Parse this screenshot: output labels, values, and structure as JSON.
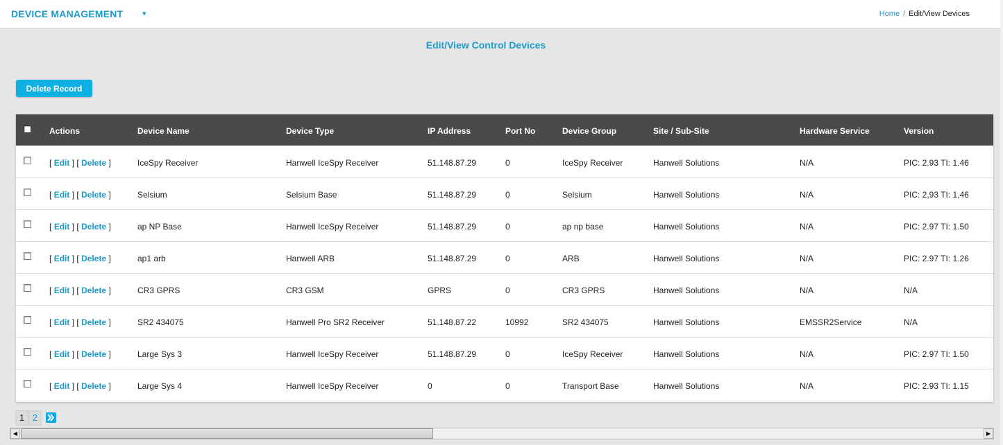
{
  "header": {
    "brand": "DEVICE MANAGEMENT",
    "brand_caret": "▾"
  },
  "breadcrumb": {
    "home": "Home",
    "separator": "/",
    "current": "Edit/View Devices"
  },
  "page_title": "Edit/View Control Devices",
  "toolbar": {
    "delete_record_label": "Delete Record"
  },
  "table": {
    "columns": [
      "Actions",
      "Device Name",
      "Device Type",
      "IP Address",
      "Port No",
      "Device Group",
      "Site / Sub-Site",
      "Hardware Service",
      "Version"
    ],
    "action_labels": {
      "open": "[",
      "edit": "Edit",
      "mid": "] [",
      "delete": "Delete",
      "close": "]"
    },
    "rows": [
      {
        "name": "IceSpy Receiver",
        "type": "Hanwell IceSpy Receiver",
        "ip": "51.148.87.29",
        "port": "0",
        "group": "IceSpy Receiver",
        "site": "Hanwell Solutions",
        "service": "N/A",
        "version": "PIC: 2.93 TI: 1.46"
      },
      {
        "name": "Selsium",
        "type": "Selsium Base",
        "ip": "51.148.87.29",
        "port": "0",
        "group": "Selsium",
        "site": "Hanwell Solutions",
        "service": "N/A",
        "version": "PIC: 2,93 TI: 1,46"
      },
      {
        "name": "ap NP Base",
        "type": "Hanwell IceSpy Receiver",
        "ip": "51.148.87.29",
        "port": "0",
        "group": "ap np base",
        "site": "Hanwell Solutions",
        "service": "N/A",
        "version": "PIC: 2.97 TI: 1.50"
      },
      {
        "name": "ap1 arb",
        "type": "Hanwell ARB",
        "ip": "51.148.87.29",
        "port": "0",
        "group": "ARB",
        "site": "Hanwell Solutions",
        "service": "N/A",
        "version": "PIC: 2.97 TI: 1.26"
      },
      {
        "name": "CR3 GPRS",
        "type": "CR3 GSM",
        "ip": "GPRS",
        "port": "0",
        "group": "CR3 GPRS",
        "site": "Hanwell Solutions",
        "service": "N/A",
        "version": "N/A"
      },
      {
        "name": "SR2 434075",
        "type": "Hanwell Pro SR2 Receiver",
        "ip": "51.148.87.22",
        "port": "10992",
        "group": "SR2 434075",
        "site": "Hanwell Solutions",
        "service": "EMSSR2Service",
        "version": "N/A"
      },
      {
        "name": "Large Sys 3",
        "type": "Hanwell IceSpy Receiver",
        "ip": "51.148.87.29",
        "port": "0",
        "group": "IceSpy Receiver",
        "site": "Hanwell Solutions",
        "service": "N/A",
        "version": "PIC: 2.97 TI: 1.50"
      },
      {
        "name": "Large Sys 4",
        "type": "Hanwell IceSpy Receiver",
        "ip": "0",
        "port": "0",
        "group": "Transport Base",
        "site": "Hanwell Solutions",
        "service": "N/A",
        "version": "PIC: 2.93 TI: 1.15"
      }
    ]
  },
  "pagination": {
    "current": "1",
    "other": "2",
    "next_icon": "next-page-icon"
  },
  "scrollbar": {
    "left_arrow": "◀",
    "right_arrow": "▶"
  },
  "colors": {
    "accent": "#1a9ccb",
    "button": "#0db0e3",
    "header_bg": "#4a4a4a"
  }
}
